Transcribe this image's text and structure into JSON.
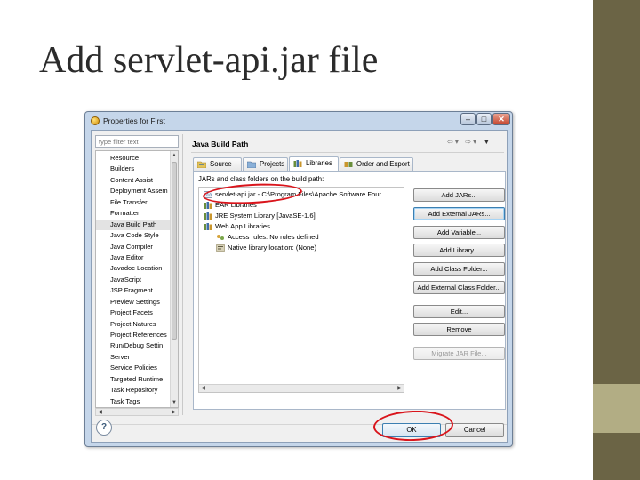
{
  "slide": {
    "title": "Add servlet-api.jar file"
  },
  "window": {
    "title": "Properties for First"
  },
  "left_panel": {
    "filter_placeholder": "type filter text",
    "items": [
      "Resource",
      "Builders",
      "Content Assist",
      "Deployment Assem",
      "File Transfer",
      "Formatter",
      "Java Build Path",
      "Java Code Style",
      "Java Compiler",
      "Java Editor",
      "Javadoc Location",
      "JavaScript",
      "JSP Fragment",
      "Preview Settings",
      "Project Facets",
      "Project Natures",
      "Project References",
      "Run/Debug Settin",
      "Server",
      "Service Policies",
      "Targeted Runtime",
      "Task Repository",
      "Task Tags"
    ],
    "selected": "Java Build Path"
  },
  "page": {
    "title": "Java Build Path",
    "tabs": [
      {
        "label": "Source"
      },
      {
        "label": "Projects"
      },
      {
        "label": "Libraries"
      },
      {
        "label": "Order and Export"
      }
    ],
    "active_tab": "Libraries",
    "jars_label": "JARs and class folders on the build path:",
    "tree": [
      {
        "text": "servlet-api.jar - C:\\Program Files\\Apache Software Four",
        "icon": "jar-icon"
      },
      {
        "text": "EAR Libraries",
        "icon": "library-icon"
      },
      {
        "text": "JRE System Library [JavaSE-1.6]",
        "icon": "library-icon"
      },
      {
        "text": "Web App Libraries",
        "icon": "library-icon"
      },
      {
        "text": "Access rules: No rules defined",
        "icon": "access-rules-icon"
      },
      {
        "text": "Native library location: (None)",
        "icon": "native-library-icon"
      }
    ],
    "buttons": {
      "add_jars": "Add JARs...",
      "add_external_jars": "Add External JARs...",
      "add_variable": "Add Variable...",
      "add_library": "Add Library...",
      "add_class_folder": "Add Class Folder...",
      "add_external_class_folder": "Add External Class Folder...",
      "edit": "Edit...",
      "remove": "Remove",
      "migrate_jar": "Migrate JAR File..."
    }
  },
  "footer": {
    "help": "?",
    "ok": "OK",
    "cancel": "Cancel"
  },
  "colors": {
    "annotation": "#d9141b",
    "slide_bar_dark": "#6b6445",
    "slide_bar_light": "#b2ad84"
  }
}
